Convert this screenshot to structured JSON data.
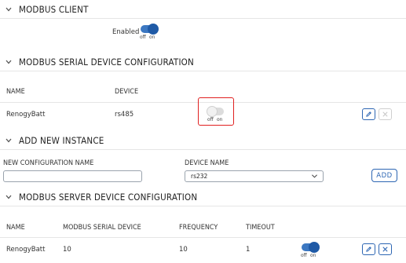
{
  "modbus_client": {
    "title": "MODBUS CLIENT",
    "enabled_label": "Enabled",
    "toggle": {
      "state": "on",
      "off_label": "off",
      "on_label": "on"
    }
  },
  "serial_config": {
    "title": "MODBUS SERIAL DEVICE CONFIGURATION",
    "columns": [
      "NAME",
      "DEVICE"
    ],
    "rows": [
      {
        "name": "RenogyBatt",
        "device": "rs485",
        "toggle": {
          "state": "off",
          "off_label": "off",
          "on_label": "on"
        }
      }
    ]
  },
  "add_instance": {
    "title": "ADD NEW INSTANCE",
    "config_name_label": "NEW CONFIGURATION NAME",
    "config_name_value": "",
    "device_name_label": "DEVICE NAME",
    "device_name_value": "rs232",
    "add_label": "ADD"
  },
  "server_config": {
    "title": "MODBUS SERVER DEVICE CONFIGURATION",
    "columns": [
      "NAME",
      "MODBUS SERIAL DEVICE",
      "FREQUENCY",
      "TIMEOUT"
    ],
    "rows": [
      {
        "name": "RenogyBatt",
        "serial_device": "10",
        "frequency": "10",
        "timeout": "1",
        "toggle": {
          "state": "on",
          "off_label": "off",
          "on_label": "on"
        }
      }
    ]
  },
  "colors": {
    "accent": "#2d66b3",
    "highlight": "#e02020",
    "divider": "#e6e6e6"
  }
}
